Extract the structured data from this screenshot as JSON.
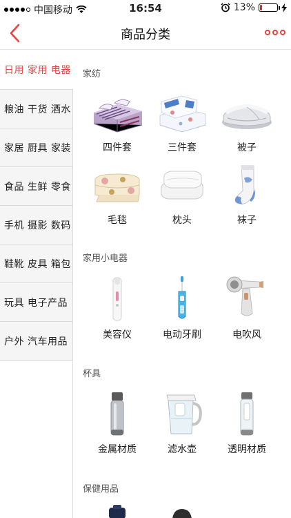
{
  "status_bar": {
    "carrier": "中国移动",
    "time": "16:54",
    "battery_percent": "13%",
    "battery_level": 0.13
  },
  "nav": {
    "title": "商品分类"
  },
  "sidebar": {
    "items": [
      {
        "label": "日用 家用 电器"
      },
      {
        "label": "粮油 干货 酒水"
      },
      {
        "label": "家居 厨具 家装"
      },
      {
        "label": "食品 生鲜 零食"
      },
      {
        "label": "手机 摄影 数码"
      },
      {
        "label": "鞋靴 皮具 箱包"
      },
      {
        "label": "玩具 电子产品"
      },
      {
        "label": "户外 汽车用品"
      }
    ]
  },
  "sections": [
    {
      "title": "家纺",
      "products": [
        {
          "label": "四件套",
          "icon": "bedding-set-icon"
        },
        {
          "label": "三件套",
          "icon": "quilt-set-icon"
        },
        {
          "label": "被子",
          "icon": "duvet-icon"
        },
        {
          "label": "毛毯",
          "icon": "blanket-icon"
        },
        {
          "label": "枕头",
          "icon": "pillow-icon"
        },
        {
          "label": "袜子",
          "icon": "sock-icon"
        }
      ]
    },
    {
      "title": "家用小电器",
      "products": [
        {
          "label": "美容仪",
          "icon": "beauty-device-icon"
        },
        {
          "label": "电动牙刷",
          "icon": "electric-toothbrush-icon"
        },
        {
          "label": "电吹风",
          "icon": "hair-dryer-icon"
        }
      ]
    },
    {
      "title": "杯具",
      "products": [
        {
          "label": "金属材质",
          "icon": "metal-bottle-icon"
        },
        {
          "label": "滤水壶",
          "icon": "water-filter-pitcher-icon"
        },
        {
          "label": "透明材质",
          "icon": "glass-bottle-icon"
        }
      ]
    },
    {
      "title": "保健用品",
      "products": []
    }
  ],
  "colors": {
    "accent": "#e64340",
    "sidebar_bg": "#f5f5f5"
  }
}
